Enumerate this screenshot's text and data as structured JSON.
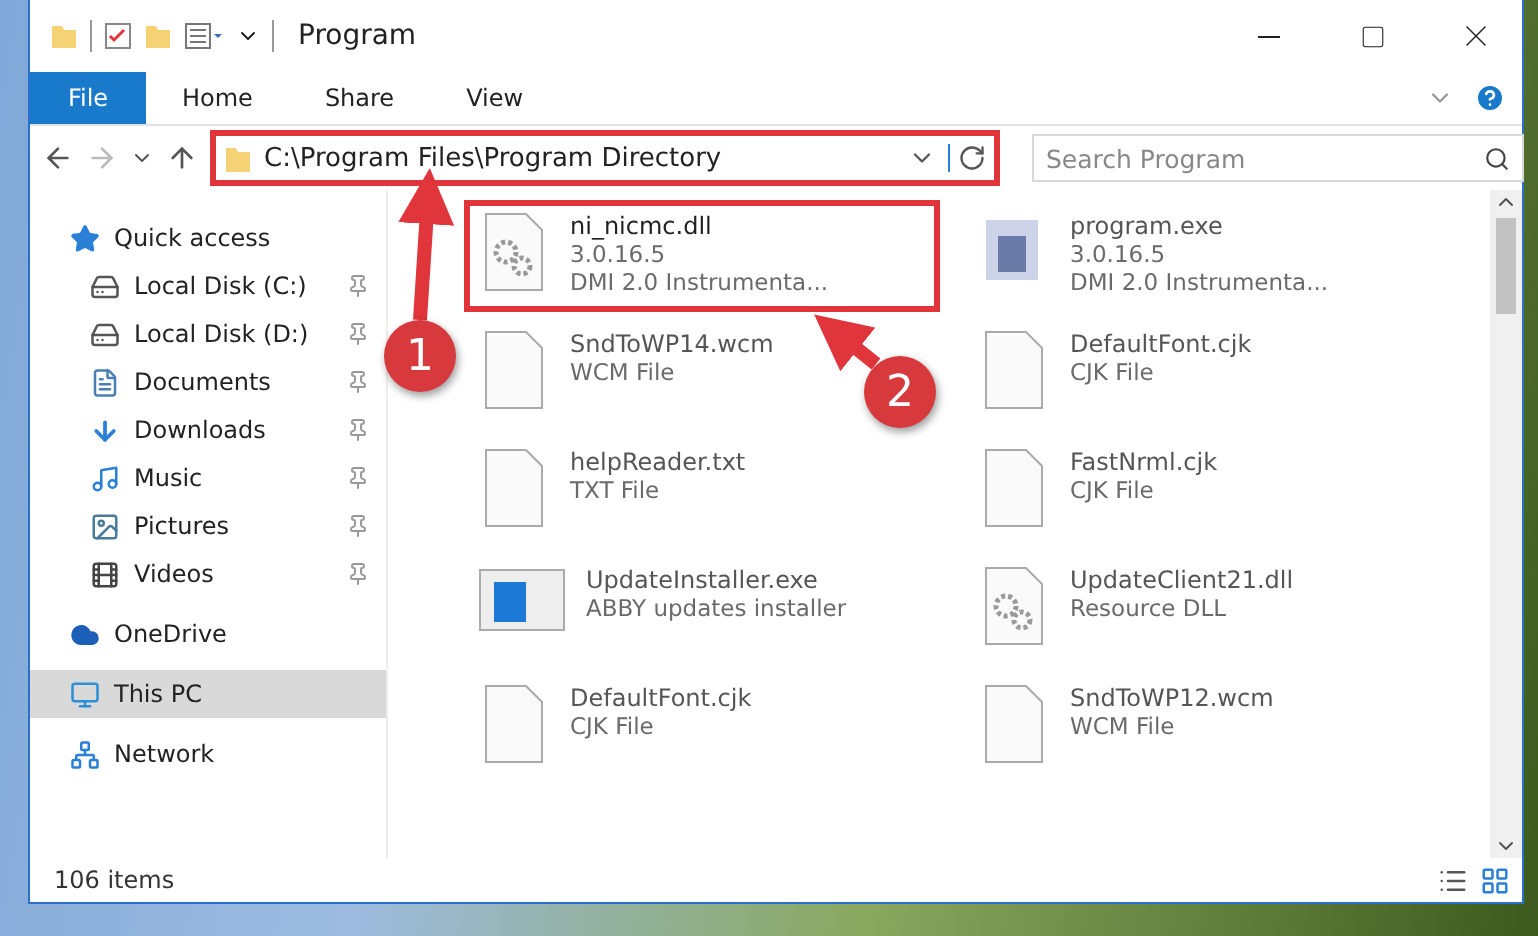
{
  "window": {
    "title": "Program"
  },
  "ribbon": {
    "tabs": [
      {
        "label": "File",
        "selected": true
      },
      {
        "label": "Home",
        "selected": false
      },
      {
        "label": "Share",
        "selected": false
      },
      {
        "label": "View",
        "selected": false
      }
    ]
  },
  "address_bar": {
    "path": "C:\\Program Files\\Program Directory",
    "highlighted": true
  },
  "search": {
    "placeholder": "Search Program"
  },
  "sidebar": {
    "items": [
      {
        "label": "Quick access",
        "kind": "star",
        "selected": false,
        "children": [
          {
            "label": "Local Disk (C:)",
            "kind": "disk",
            "pinned": true
          },
          {
            "label": "Local Disk (D:)",
            "kind": "disk",
            "pinned": true
          },
          {
            "label": "Documents",
            "kind": "documents",
            "pinned": true
          },
          {
            "label": "Downloads",
            "kind": "downloads",
            "pinned": true
          },
          {
            "label": "Music",
            "kind": "music",
            "pinned": true
          },
          {
            "label": "Pictures",
            "kind": "pictures",
            "pinned": true
          },
          {
            "label": "Videos",
            "kind": "videos",
            "pinned": true
          }
        ]
      },
      {
        "label": "OneDrive",
        "kind": "cloud",
        "selected": false
      },
      {
        "label": "This PC",
        "kind": "pc",
        "selected": true
      },
      {
        "label": "Network",
        "kind": "network",
        "selected": false
      }
    ]
  },
  "files": [
    {
      "name": "ni_nicmc.dll",
      "details": [
        "3.0.16.5",
        "DMI 2.0 Instrumenta..."
      ],
      "kind": "dll",
      "highlighted": true
    },
    {
      "name": "program.exe",
      "details": [
        "3.0.16.5",
        "DMI 2.0 Instrumenta..."
      ],
      "kind": "exe",
      "highlighted": false
    },
    {
      "name": "SndToWP14.wcm",
      "details": [
        "WCM File"
      ],
      "kind": "blank",
      "highlighted": false
    },
    {
      "name": "DefaultFont.cjk",
      "details": [
        "CJK File"
      ],
      "kind": "blank",
      "highlighted": false
    },
    {
      "name": "helpReader.txt",
      "details": [
        "TXT File"
      ],
      "kind": "blank",
      "highlighted": false
    },
    {
      "name": "FastNrml.cjk",
      "details": [
        "CJK File"
      ],
      "kind": "blank",
      "highlighted": false
    },
    {
      "name": "UpdateInstaller.exe",
      "details": [
        "ABBY updates installer"
      ],
      "kind": "installer",
      "highlighted": false
    },
    {
      "name": "UpdateClient21.dll",
      "details": [
        "Resource DLL"
      ],
      "kind": "dll",
      "highlighted": false
    },
    {
      "name": "DefaultFont.cjk",
      "details": [
        "CJK File"
      ],
      "kind": "blank",
      "highlighted": false
    },
    {
      "name": "SndToWP12.wcm",
      "details": [
        "WCM File"
      ],
      "kind": "blank",
      "highlighted": false
    }
  ],
  "status_bar": {
    "item_count": "106 items"
  },
  "annotations": [
    {
      "label": "1"
    },
    {
      "label": "2"
    }
  ]
}
